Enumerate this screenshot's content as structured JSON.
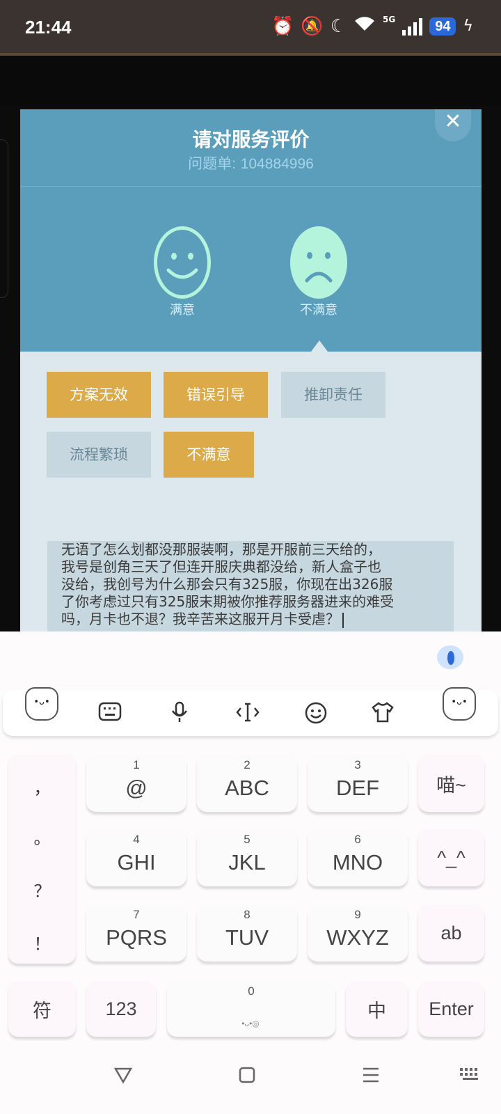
{
  "status_bar": {
    "time": "21:44",
    "network": "5G",
    "battery": "94",
    "icons": [
      "alarm-icon",
      "mute-icon",
      "moon-icon",
      "wifi-icon",
      "signal-icon",
      "battery-icon",
      "charging-icon"
    ]
  },
  "dialog": {
    "title": "请对服务评价",
    "ticket_label": "问题单:",
    "ticket_number": "104884996",
    "close": "✕",
    "rating": {
      "satisfied_label": "满意",
      "unsatisfied_label": "不满意",
      "selected": "unsatisfied"
    },
    "tags": [
      {
        "label": "方案无效",
        "selected": true
      },
      {
        "label": "错误引导",
        "selected": true
      },
      {
        "label": "推卸责任",
        "selected": false
      },
      {
        "label": "流程繁琐",
        "selected": false
      },
      {
        "label": "不满意",
        "selected": true
      }
    ],
    "feedback_lines": [
      "无语了怎么划都没那服装啊，那是开服前三天给的，",
      "我号是创角三天了但连开服庆典都没给，新人盒子也",
      "没给，我创号为什么那会只有325服，你现在出326服",
      "了你考虑过只有325服末期被你推荐服务器进来的难受",
      "吗，月卡也不退？我辛苦来这服开月卡受虐？"
    ]
  },
  "keyboard": {
    "toolbar_icons": [
      "keyboard-layout-icon",
      "microphone-icon",
      "cursor-icon",
      "emoji-icon",
      "skin-icon"
    ],
    "punctuation": [
      "，",
      "。",
      "？",
      "！"
    ],
    "keys": [
      {
        "num": "1",
        "label": "@"
      },
      {
        "num": "2",
        "label": "ABC"
      },
      {
        "num": "3",
        "label": "DEF"
      },
      {
        "num": "4",
        "label": "GHI"
      },
      {
        "num": "5",
        "label": "JKL"
      },
      {
        "num": "6",
        "label": "MNO"
      },
      {
        "num": "7",
        "label": "PQRS"
      },
      {
        "num": "8",
        "label": "TUV"
      },
      {
        "num": "9",
        "label": "WXYZ"
      }
    ],
    "side_keys": [
      "喵~",
      "^_^",
      "ab"
    ],
    "bottom": {
      "symbols": "符",
      "numbers": "123",
      "space_num": "0",
      "chinese": "中",
      "enter": "Enter"
    }
  },
  "navbar": {
    "icons": [
      "back-icon",
      "home-icon",
      "menu-icon",
      "keyboard-hide-icon"
    ]
  }
}
